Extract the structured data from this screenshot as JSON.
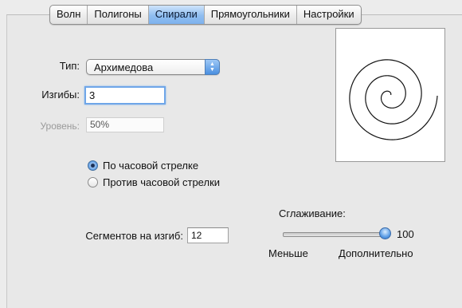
{
  "tabs": [
    {
      "label": "Волн"
    },
    {
      "label": "Полигоны"
    },
    {
      "label": "Спирали",
      "active": true
    },
    {
      "label": "Прямоугольники"
    },
    {
      "label": "Настройки"
    }
  ],
  "type": {
    "label": "Тип:",
    "value": "Архимедова"
  },
  "bends": {
    "label": "Изгибы:",
    "value": "3"
  },
  "level": {
    "label": "Уровень:",
    "value": "50%"
  },
  "direction": {
    "clockwise": "По часовой стрелке",
    "counterclockwise": "Против часовой стрелки",
    "selected": "clockwise"
  },
  "segments": {
    "label": "Сегментов на изгиб:",
    "value": "12"
  },
  "smoothing": {
    "label": "Сглаживание:",
    "value": "100",
    "level_fraction": 1.0,
    "min_label": "Меньше",
    "max_label": "Дополнительно"
  },
  "colors": {
    "accent": "#4a8fe0",
    "active_tab": "#8fbdf0"
  },
  "icons": {
    "select_arrows": "up-down-arrows-icon",
    "slider_thumb": "slider-knob"
  }
}
